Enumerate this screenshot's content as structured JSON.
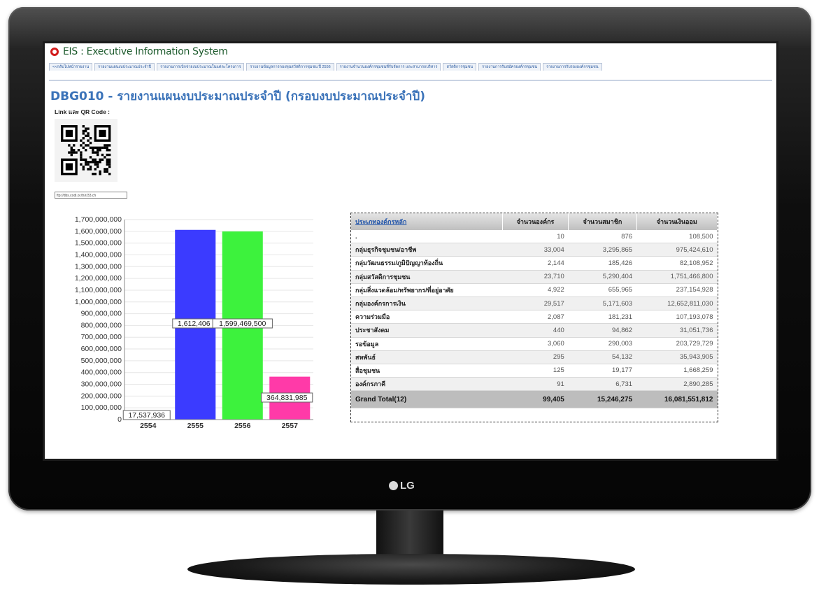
{
  "app": {
    "title": "EIS : Executive Information System",
    "brand_color": "#d21b1b"
  },
  "tabs": [
    "<<กลับไปหน้ารายงาน",
    "รายงานแผนงบประมาณประจำปี",
    "รายงานการเบิกจ่ายงบประมาณในแต่ละโครงการ",
    "รายงานข้อมูลการกองทุนสวัสดิการชุมชน ปี 2556",
    "รายงานจำนวนองค์กรชุมชนที่รับจัดการ และสามารถบริหาร",
    "สวัสดิการชุมชน",
    "รายงานการรับสมัครองค์กรชุมชน",
    "รายงานการรับรององค์กรชุมชน"
  ],
  "page": {
    "title": "DBG010 - รายงานแผนงบประมาณประจำปี (กรอบงบประมาณประจำปี)",
    "qr_label": "Link และ QR Code :",
    "qr_url": "ftp://dbs.codi.or.th/r/33.ch"
  },
  "chart_data": {
    "type": "bar",
    "categories": [
      "2554",
      "2555",
      "2556",
      "2557"
    ],
    "values": [
      17537936,
      1612406,
      1599469500,
      364831985
    ],
    "data_labels": [
      "17,537,936",
      "1,612,406",
      "1,599,469,500",
      "364,831,985"
    ],
    "bar_heights": [
      17537936,
      1612406000,
      1599469500,
      364831985
    ],
    "colors": [
      "#ffffff",
      "#3b3bff",
      "#3df23d",
      "#ff3aa8"
    ],
    "ylim": [
      0,
      1700000000
    ],
    "yticks": [
      "0",
      "100,000,000",
      "200,000,000",
      "300,000,000",
      "400,000,000",
      "500,000,000",
      "600,000,000",
      "700,000,000",
      "800,000,000",
      "900,000,000",
      "1,000,000,000",
      "1,100,000,000",
      "1,200,000,000",
      "1,300,000,000",
      "1,400,000,000",
      "1,500,000,000",
      "1,600,000,000",
      "1,700,000,000"
    ],
    "title": "",
    "xlabel": "",
    "ylabel": "",
    "grid": true
  },
  "table": {
    "headers": [
      "ประเภทองค์กรหลัก",
      "จำนวนองค์กร",
      "จำนวนสมาชิก",
      "จำนวนเงินออม"
    ],
    "rows": [
      [
        ".",
        "10",
        "876",
        "108,500"
      ],
      [
        "กลุ่มธุรกิจชุมชน/อาชีพ",
        "33,004",
        "3,295,865",
        "975,424,610"
      ],
      [
        "กลุ่มวัฒนธรรม/ภูมิปัญญาท้องถิ่น",
        "2,144",
        "185,426",
        "82,108,952"
      ],
      [
        "กลุ่มสวัสดิการชุมชน",
        "23,710",
        "5,290,404",
        "1,751,466,800"
      ],
      [
        "กลุ่มสิ่งแวดล้อม/ทรัพยากร/ที่อยู่อาศัย",
        "4,922",
        "655,965",
        "237,154,928"
      ],
      [
        "กลุ่มองค์กรการเงิน",
        "29,517",
        "5,171,603",
        "12,652,811,030"
      ],
      [
        "ความร่วมมือ",
        "2,087",
        "181,231",
        "107,193,078"
      ],
      [
        "ประชาสังคม",
        "440",
        "94,862",
        "31,051,736"
      ],
      [
        "รอข้อมูล",
        "3,060",
        "290,003",
        "203,729,729"
      ],
      [
        "สหพันธ์",
        "295",
        "54,132",
        "35,943,905"
      ],
      [
        "สื่อชุมชน",
        "125",
        "19,177",
        "1,668,259"
      ],
      [
        "องค์กรภาคี",
        "91",
        "6,731",
        "2,890,285"
      ]
    ],
    "total": [
      "Grand Total(12)",
      "99,405",
      "15,246,275",
      "16,081,551,812"
    ]
  },
  "monitor": {
    "brand": "LG"
  }
}
